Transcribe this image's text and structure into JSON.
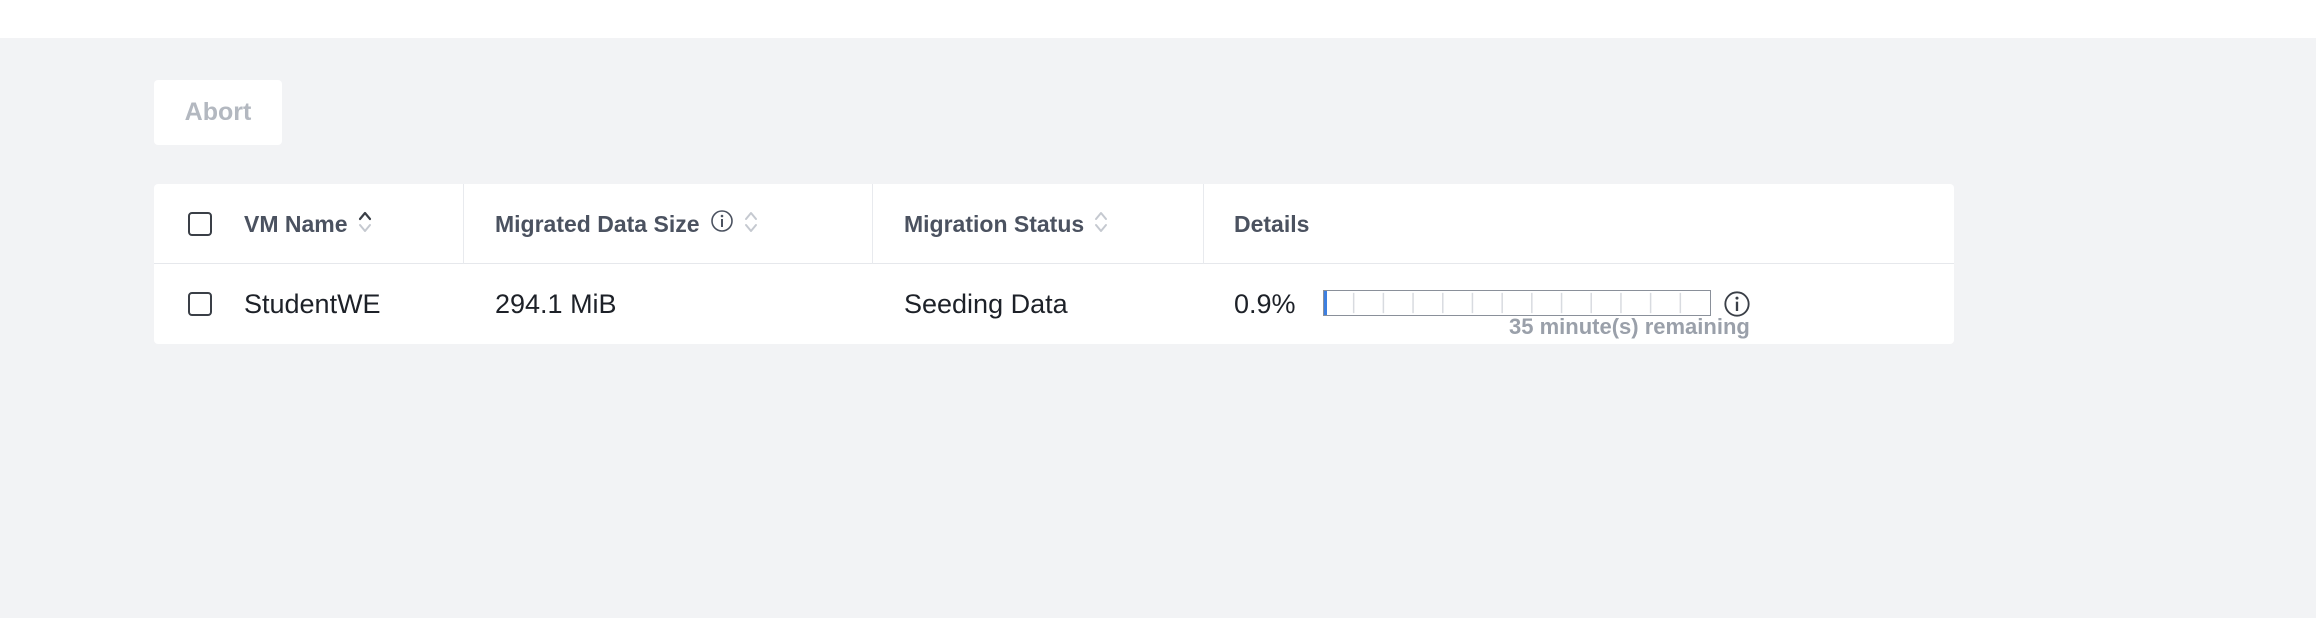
{
  "toolbar": {
    "abort_label": "Abort"
  },
  "table": {
    "columns": [
      {
        "label": "VM Name",
        "sort": "ascending"
      },
      {
        "label": "Migrated Data Size",
        "sort": "none",
        "info": true
      },
      {
        "label": "Migration Status",
        "sort": "none"
      },
      {
        "label": "Details"
      }
    ],
    "rows": [
      {
        "vm_name": "StudentWE",
        "migrated_data_size": "294.1 MiB",
        "migration_status": "Seeding Data",
        "details": {
          "percent_label": "0.9%",
          "progress": 0.009,
          "remaining": "35 minute(s) remaining"
        }
      }
    ]
  },
  "icons": {
    "sort_active": "sort-ascending-icon",
    "sort_inactive": "sort-icon",
    "info": "info-icon"
  },
  "colors": {
    "background": "#f2f3f5",
    "disabled_text": "#b3b8c0",
    "progress": "#3d7fe0"
  }
}
